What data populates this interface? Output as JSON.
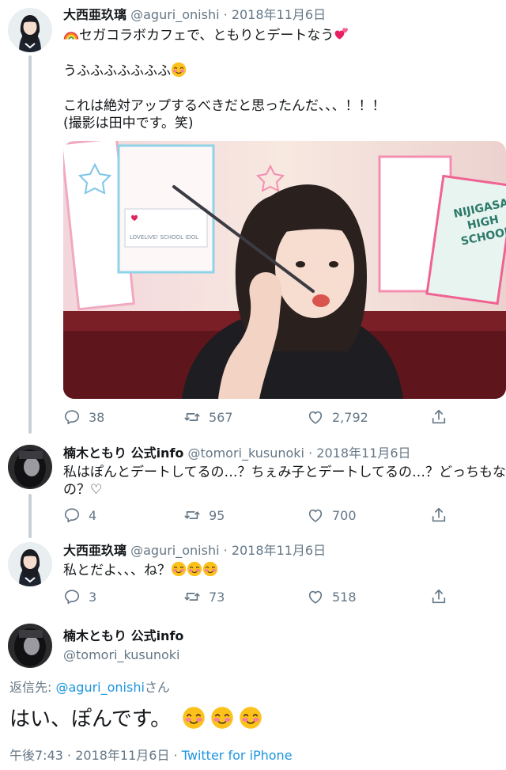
{
  "tweets": [
    {
      "name": "大西亜玖璃",
      "handle": "@aguri_onishi",
      "dot": "·",
      "date": "2018年11月6日",
      "lines": [
        "セガコラボカフェで、ともりとデートなう",
        "うふふふふふふふ",
        "これは絶対アップするべきだと思ったんだ、、、！！！",
        "(撮影は田中です。笑)"
      ],
      "replies": "38",
      "retweets": "567",
      "likes": "2,792"
    },
    {
      "name": "楠木ともり 公式info",
      "handle": "@tomori_kusunoki",
      "dot": "·",
      "date": "2018年11月6日",
      "lines": [
        "私はぽんとデートしてるの…？ちぇみ子とデートしてるの…？どっちもな",
        "の？♡"
      ],
      "replies": "4",
      "retweets": "95",
      "likes": "700"
    },
    {
      "name": "大西亜玖璃",
      "handle": "@aguri_onishi",
      "dot": "·",
      "date": "2018年11月6日",
      "lines": [
        "私とだよ、、、ね？"
      ],
      "replies": "3",
      "retweets": "73",
      "likes": "518"
    }
  ],
  "main_tweet": {
    "name": "楠木ともり 公式info",
    "handle": "@tomori_kusunoki",
    "reply_prefix": "返信先: ",
    "reply_mention": "@aguri_onishi",
    "reply_suffix": "さん",
    "text": "はい、ぽんです。",
    "time": "午後7:43",
    "sep": " · ",
    "date": "2018年11月6日",
    "source": "Twitter for iPhone"
  },
  "photo_signs": {
    "school_line1": "NIJIGASAKI",
    "school_line2": "HIGH",
    "school_line3": "SCHOOL!",
    "card_caption": "LOVELIVE! SCHOOL IDOL"
  },
  "colors": {
    "accent": "#1b95e0",
    "muted": "#657786",
    "text": "#14171a",
    "heart": "#e0245e"
  },
  "icons": [
    "reply-icon",
    "retweet-icon",
    "like-icon",
    "share-icon",
    "rainbow-emoji",
    "heart-emoji",
    "blush-emoji"
  ]
}
